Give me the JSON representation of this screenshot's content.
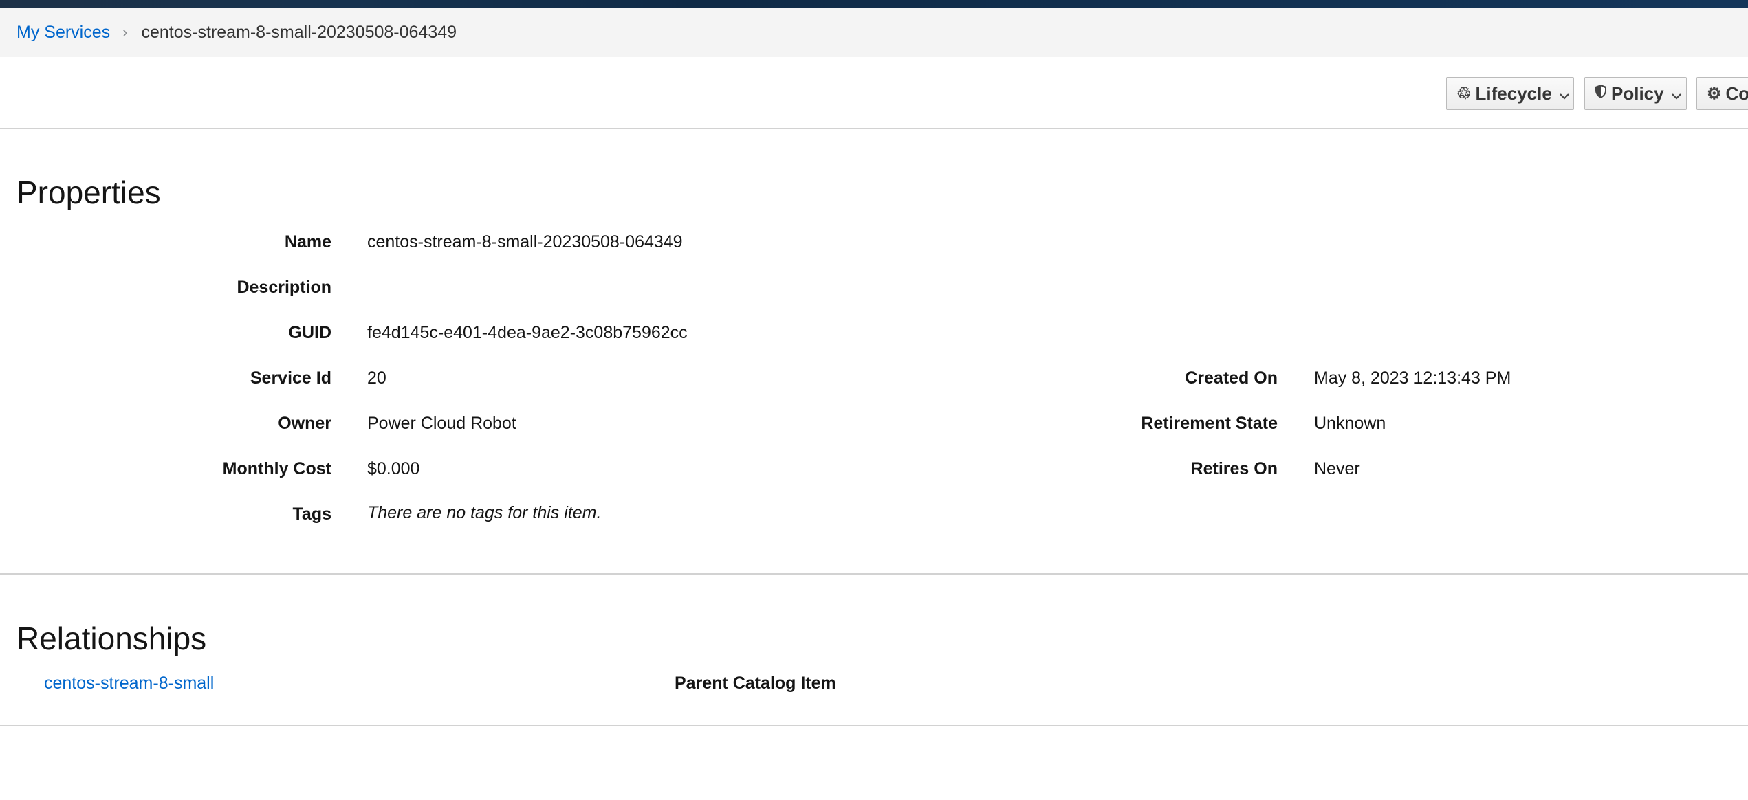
{
  "breadcrumb": {
    "parent": "My Services",
    "separator": "›",
    "current": "centos-stream-8-small-20230508-064349"
  },
  "toolbar": {
    "lifecycle": {
      "label": "Lifecycle",
      "icon": "recycle-icon"
    },
    "policy": {
      "label": "Policy",
      "icon": "shield-icon"
    },
    "configuration": {
      "label": "Con",
      "icon": "gear-icon"
    }
  },
  "properties": {
    "title": "Properties",
    "left": [
      {
        "label": "Name",
        "value": "centos-stream-8-small-20230508-064349"
      },
      {
        "label": "Description",
        "value": ""
      },
      {
        "label": "GUID",
        "value": "fe4d145c-e401-4dea-9ae2-3c08b75962cc"
      },
      {
        "label": "Service Id",
        "value": "20"
      },
      {
        "label": "Owner",
        "value": "Power Cloud Robot"
      },
      {
        "label": "Monthly Cost",
        "value": "$0.000"
      },
      {
        "label": "Tags",
        "value": "There are no tags for this item."
      }
    ],
    "right": [
      {
        "label": "Created On",
        "value": "May 8, 2023 12:13:43 PM"
      },
      {
        "label": "Retirement State",
        "value": "Unknown"
      },
      {
        "label": "Retires On",
        "value": "Never"
      }
    ]
  },
  "relationships": {
    "title": "Relationships",
    "items": [
      {
        "link": "centos-stream-8-small",
        "label": "Parent Catalog Item"
      }
    ]
  },
  "colors": {
    "link": "#0066cc",
    "header": "#14365a",
    "breadcrumb_bg": "#f4f4f4",
    "divider": "#d2d2d2"
  }
}
